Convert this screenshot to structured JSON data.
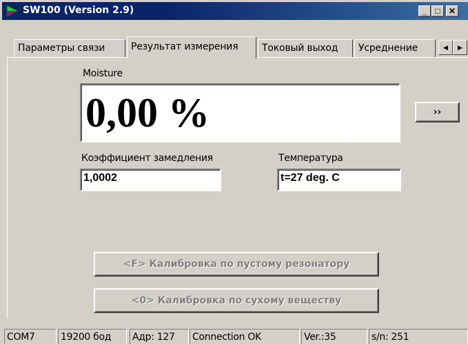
{
  "window": {
    "title": "SW100 (Version 2.9)",
    "controls": {
      "minimize": "_",
      "maximize": "□",
      "close": "✕"
    }
  },
  "tabs": [
    {
      "label": "Параметры связи",
      "active": false
    },
    {
      "label": "Результат измерения",
      "active": true
    },
    {
      "label": "Токовый выход",
      "active": false
    },
    {
      "label": "Усреднение",
      "active": false
    }
  ],
  "tab_scroll": {
    "left": "◀",
    "right": "▶"
  },
  "measurement": {
    "moisture_label": "Moisture",
    "moisture_value": "0,00 %",
    "expand_button": "››",
    "slowdown_label": "Коэффициент замедления",
    "slowdown_value": "1,0002",
    "temperature_label": "Температура",
    "temperature_value": "t=27 deg. C"
  },
  "calibration": {
    "empty_resonator": "<F> Калибровка по пустому резонатору",
    "dry_substance": "<0> Калибровка по сухому веществу"
  },
  "status_bar": {
    "port": "COM7",
    "baud": "19200 бод",
    "address": "Адр: 127",
    "connection": "Connection OK",
    "version": "Ver.:35",
    "serial": "s/n: 251"
  }
}
